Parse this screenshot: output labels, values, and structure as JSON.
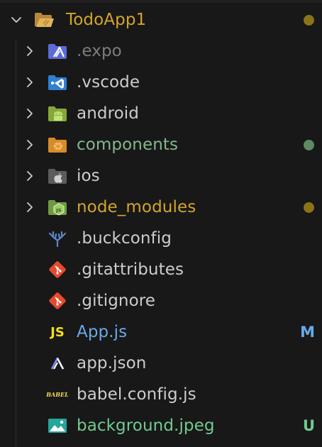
{
  "explorer": {
    "root": {
      "label": "TodoApp1",
      "color": "#d4a52c",
      "decoration": "dot",
      "decoration_color": "#8a7318",
      "icon": "folder-open-icon"
    },
    "items": [
      {
        "label": ".expo",
        "color": "#7d7d7d",
        "kind": "folder",
        "icon": "expo-folder-icon",
        "decoration": null
      },
      {
        "label": ".vscode",
        "color": "#cccccc",
        "kind": "folder",
        "icon": "vscode-folder-icon",
        "decoration": null
      },
      {
        "label": "android",
        "color": "#cccccc",
        "kind": "folder",
        "icon": "android-folder-icon",
        "decoration": null
      },
      {
        "label": "components",
        "color": "#81b88b",
        "kind": "folder",
        "icon": "components-folder-icon",
        "decoration": "dot",
        "decoration_color": "#5e8a63"
      },
      {
        "label": "ios",
        "color": "#cccccc",
        "kind": "folder",
        "icon": "apple-folder-icon",
        "decoration": null
      },
      {
        "label": "node_modules",
        "color": "#d4a52c",
        "kind": "folder",
        "icon": "node-folder-icon",
        "decoration": "dot",
        "decoration_color": "#8a7318"
      },
      {
        "label": ".buckconfig",
        "color": "#cccccc",
        "kind": "file",
        "icon": "buck-icon",
        "decoration": null
      },
      {
        "label": ".gitattributes",
        "color": "#cccccc",
        "kind": "file",
        "icon": "git-icon",
        "decoration": null
      },
      {
        "label": ".gitignore",
        "color": "#cccccc",
        "kind": "file",
        "icon": "git-icon",
        "decoration": null
      },
      {
        "label": "App.js",
        "color": "#6aa9e9",
        "kind": "file",
        "icon": "javascript-icon",
        "icon_text": "JS",
        "decoration": "letter",
        "decoration_text": "M",
        "decoration_color": "#6aa9e9"
      },
      {
        "label": "app.json",
        "color": "#cccccc",
        "kind": "file",
        "icon": "expo-icon",
        "decoration": null
      },
      {
        "label": "babel.config.js",
        "color": "#cccccc",
        "kind": "file",
        "icon": "babel-icon",
        "icon_text": "BABEL",
        "decoration": null
      },
      {
        "label": "background.jpeg",
        "color": "#73c991",
        "kind": "file",
        "icon": "image-icon",
        "decoration": "letter",
        "decoration_text": "U",
        "decoration_color": "#73c991"
      }
    ]
  }
}
